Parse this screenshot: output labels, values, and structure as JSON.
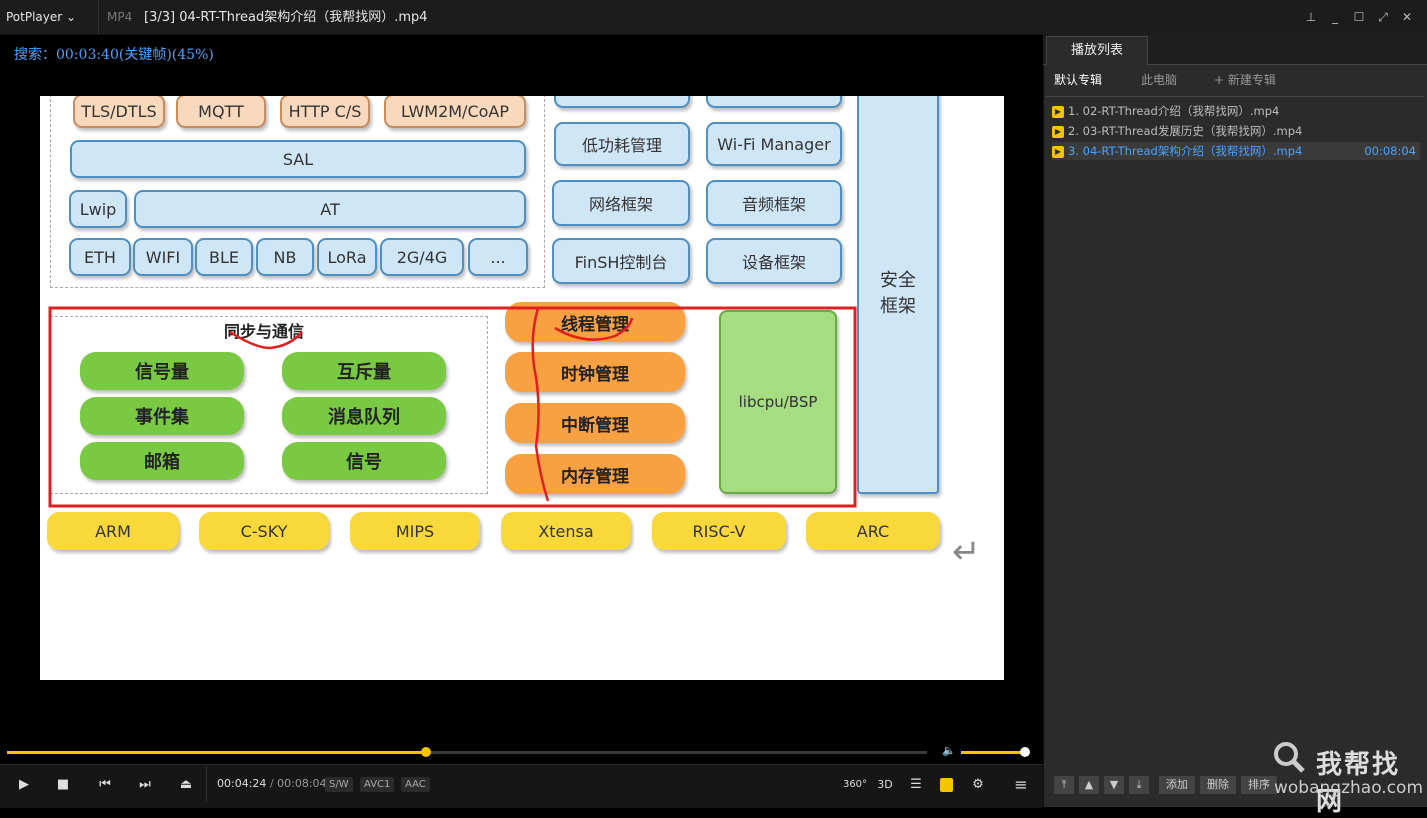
{
  "titlebar": {
    "app_name": "PotPlayer",
    "format": "MP4",
    "title": "[3/3] 04-RT-Thread架构介绍（我帮找网）.mp4"
  },
  "osd": {
    "text": "搜索：00:03:40(关键帧)(45%)"
  },
  "slide": {
    "top_row": [
      "TLS/DTLS",
      "MQTT",
      "HTTP C/S",
      "LWM2M/CoAP"
    ],
    "sal": "SAL",
    "lwip": "Lwip",
    "at": "AT",
    "net_row": [
      "ETH",
      "WIFI",
      "BLE",
      "NB",
      "LoRa",
      "2G/4G",
      "..."
    ],
    "components": [
      "低功耗管理",
      "Wi-Fi Manager",
      "网络框架",
      "音频框架",
      "FinSH控制台",
      "设备框架"
    ],
    "security": "安全\n框架",
    "sync_title": "同步与通信",
    "sync_items": [
      "信号量",
      "互斥量",
      "事件集",
      "消息队列",
      "邮箱",
      "信号"
    ],
    "kernel_items": [
      "线程管理",
      "时钟管理",
      "中断管理",
      "内存管理"
    ],
    "libcpu": "libcpu/BSP",
    "arch_row": [
      "ARM",
      "C-SKY",
      "MIPS",
      "Xtensa",
      "RISC-V",
      "ARC"
    ],
    "return_glyph": "↵"
  },
  "player": {
    "progress_fraction": 0.455,
    "volume_fraction": 1.0,
    "current_time": "00:04:24",
    "separator": "/",
    "total_time": "00:08:04",
    "tags": [
      "S/W",
      "AVC1",
      "AAC"
    ],
    "right_icons": [
      "360°",
      "3D"
    ]
  },
  "playlist": {
    "tab": "播放列表",
    "subtabs": [
      "默认专辑",
      "此电脑",
      "+ 新建专辑"
    ],
    "items": [
      {
        "label": "1. 02-RT-Thread介绍（我帮找网）.mp4",
        "duration": ""
      },
      {
        "label": "2. 03-RT-Thread发展历史（我帮找网）.mp4",
        "duration": ""
      },
      {
        "label": "3. 04-RT-Thread架构介绍（我帮找网）.mp4",
        "duration": "00:08:04"
      }
    ],
    "buttons": [
      "添加",
      "删除",
      "排序"
    ]
  },
  "watermark": {
    "text": "我帮找网",
    "url": "wobangzhao.com"
  },
  "colors": {
    "accent": "#f5c400",
    "osd": "#4aa3ff",
    "highlight": "#e02020"
  }
}
